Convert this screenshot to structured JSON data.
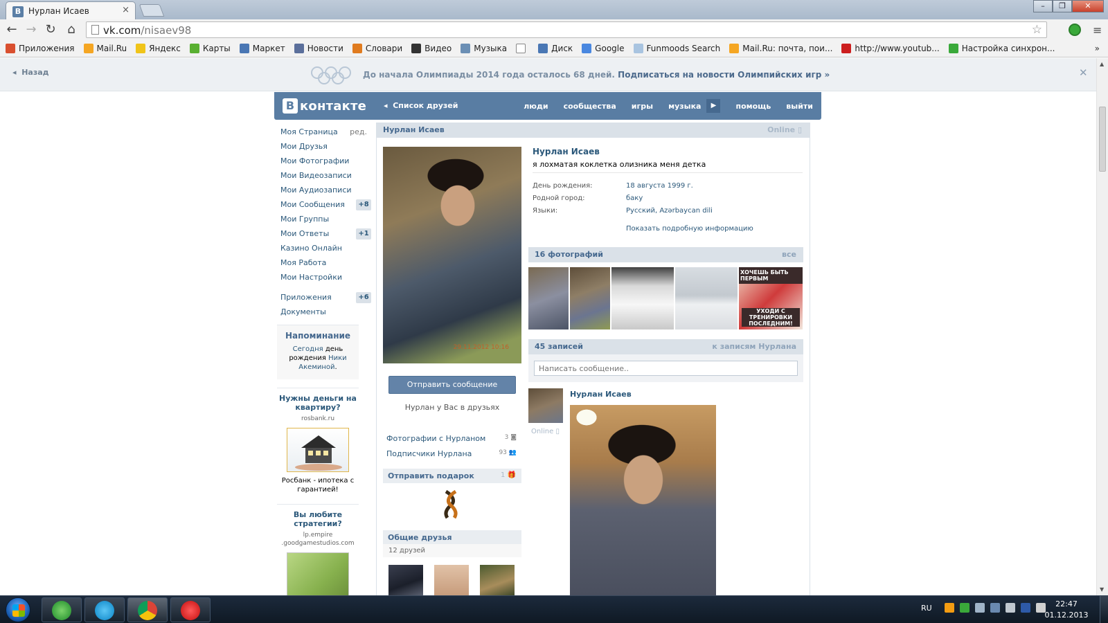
{
  "browser": {
    "tab_title": "Нурлан Исаев",
    "tab_favicon": "В",
    "url_host": "vk.com",
    "url_path": "/nisaev98",
    "bookmarks": [
      {
        "label": "Приложения",
        "icon": "apps-grid-icon",
        "color": "#d94f2f"
      },
      {
        "label": "Mail.Ru",
        "icon": "mailru-icon",
        "color": "#f5a623"
      },
      {
        "label": "Яндекс",
        "icon": "yandex-icon",
        "color": "#f0c419"
      },
      {
        "label": "Карты",
        "icon": "maps-icon",
        "color": "#59b031"
      },
      {
        "label": "Маркет",
        "icon": "market-icon",
        "color": "#4a77b4"
      },
      {
        "label": "Новости",
        "icon": "news-icon",
        "color": "#5b6f9b"
      },
      {
        "label": "Словари",
        "icon": "dictionary-icon",
        "color": "#e07b1f"
      },
      {
        "label": "Видео",
        "icon": "video-icon",
        "color": "#333333"
      },
      {
        "label": "Музыка",
        "icon": "music-icon",
        "color": "#6b8fb5"
      },
      {
        "label": "",
        "icon": "page-icon",
        "color": "#ffffff"
      },
      {
        "label": "Диск",
        "icon": "disk-icon",
        "color": "#4a77b4"
      },
      {
        "label": "Google",
        "icon": "google-icon",
        "color": "#4a88e0"
      },
      {
        "label": "Funmoods Search",
        "icon": "funmoods-icon",
        "color": "#a9c4e0"
      },
      {
        "label": "Mail.Ru: почта, пои...",
        "icon": "mailru-icon",
        "color": "#f5a623"
      },
      {
        "label": "http://www.youtub...",
        "icon": "youtube-icon",
        "color": "#cc1e1e"
      },
      {
        "label": "Настройка синхрон...",
        "icon": "google-sync-icon",
        "color": "#3aa93a"
      }
    ],
    "bookmarks_more": "»"
  },
  "banner": {
    "back": "Назад",
    "text_prefix": "До начала Олимпиады 2014 года осталось 68 дней.",
    "text_link": "Подписаться на новости Олимпийских игр »",
    "close": "✕"
  },
  "vk_header": {
    "logo_letter": "В",
    "logo_text": "контакте",
    "friends_link": "Список друзей",
    "nav": [
      "люди",
      "сообщества",
      "игры",
      "музыка",
      "помощь",
      "выйти"
    ]
  },
  "left_menu": {
    "items": [
      {
        "label": "Моя Страница",
        "extra": "ред."
      },
      {
        "label": "Мои Друзья"
      },
      {
        "label": "Мои Фотографии"
      },
      {
        "label": "Мои Видеозаписи"
      },
      {
        "label": "Мои Аудиозаписи"
      },
      {
        "label": "Мои Сообщения",
        "badge": "+8"
      },
      {
        "label": "Мои Группы"
      },
      {
        "label": "Мои Ответы",
        "badge": "+1"
      },
      {
        "label": "Казино Онлайн"
      },
      {
        "label": "Моя Работа"
      },
      {
        "label": "Мои Настройки"
      }
    ],
    "items2": [
      {
        "label": "Приложения",
        "badge": "+6"
      },
      {
        "label": "Документы"
      }
    ],
    "reminder": {
      "title": "Напоминание",
      "today": "Сегодня",
      "birthday": "день рождения",
      "name": "Ники Акеминой",
      "dot": "."
    },
    "ad1": {
      "title": "Нужны деньги на квартиру?",
      "domain": "rosbank.ru",
      "desc": "Росбанк - ипотека с гарантией!"
    },
    "ad2": {
      "title": "Вы любите стратегии?",
      "domain": "lp.empire .goodgamestudios.com"
    }
  },
  "profile": {
    "name": "Нурлан Исаев",
    "online": "Online",
    "status": "я лохматая коклетка олизника меня детка",
    "avatar_date": "29.11.2012 10:16",
    "fields": [
      {
        "label": "День рождения:",
        "value": "18 августа 1999 г."
      },
      {
        "label": "Родной город:",
        "value": "баку"
      },
      {
        "label": "Языки:",
        "value": "Русский, Azərbaycan dili"
      }
    ],
    "more_info": "Показать подробную информацию",
    "send_message": "Отправить сообщение",
    "friends_note": "Нурлан у Вас в друзьях",
    "photos_with": {
      "label": "Фотографии с Нурланом",
      "count": "3"
    },
    "followers": {
      "label": "Подписчики Нурлана",
      "count": "93"
    },
    "gift": {
      "title": "Отправить подарок",
      "count": "1"
    },
    "common_friends": {
      "title": "Общие друзья",
      "count": "12 друзей"
    }
  },
  "photos_section": {
    "title": "16 фотографий",
    "all": "все",
    "promo_text_top": "ХОЧЕШЬ БЫТЬ ПЕРВЫМ",
    "promo_text_bottom": "УХОДИ С ТРЕНИРОВКИ ПОСЛЕДНИМ!"
  },
  "wall": {
    "title": "45 записей",
    "link": "к записям Нурлана",
    "placeholder": "Написать сообщение..",
    "post_author": "Нурлан Исаев",
    "post_online": "Online"
  },
  "taskbar": {
    "lang": "RU",
    "time": "22:47",
    "date": "01.12.2013"
  }
}
